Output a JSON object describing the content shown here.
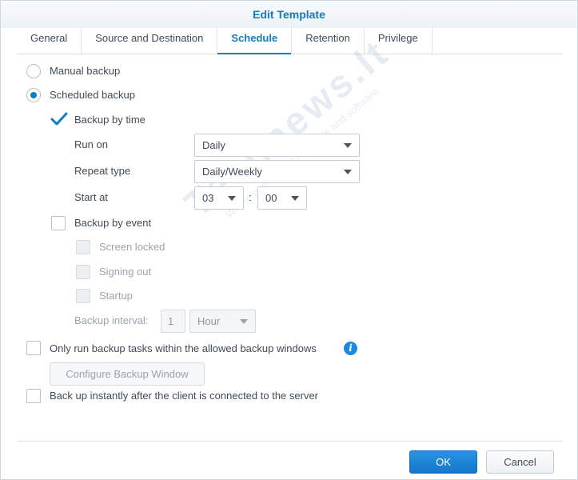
{
  "title": "Edit Template",
  "tabs": [
    {
      "label": "General",
      "active": false
    },
    {
      "label": "Source and Destination",
      "active": false
    },
    {
      "label": "Schedule",
      "active": true
    },
    {
      "label": "Retention",
      "active": false
    },
    {
      "label": "Privilege",
      "active": false
    }
  ],
  "schedule": {
    "manual_backup": {
      "label": "Manual backup",
      "checked": false
    },
    "scheduled_backup": {
      "label": "Scheduled backup",
      "checked": true
    },
    "backup_by_time": {
      "label": "Backup by time",
      "checked": true,
      "run_on": {
        "label": "Run on",
        "value": "Daily"
      },
      "repeat_type": {
        "label": "Repeat type",
        "value": "Daily/Weekly"
      },
      "start_at": {
        "label": "Start at",
        "hour": "03",
        "separator": ":",
        "minute": "00"
      }
    },
    "backup_by_event": {
      "label": "Backup by event",
      "checked": false,
      "events": [
        {
          "label": "Screen locked",
          "checked": false
        },
        {
          "label": "Signing out",
          "checked": false
        },
        {
          "label": "Startup",
          "checked": false
        }
      ],
      "interval": {
        "label": "Backup interval:",
        "value": "1",
        "unit": "Hour"
      }
    },
    "backup_window": {
      "label": "Only run backup tasks within the allowed backup windows",
      "checked": false
    },
    "configure_button": "Configure Backup Window",
    "instant_backup": {
      "label": "Back up instantly after the client is connected to the server",
      "checked": false
    }
  },
  "buttons": {
    "ok": "OK",
    "cancel": "Cancel"
  },
  "watermark": {
    "brand": "Technews.lt",
    "tagline": "Where geeks meet hardware and software"
  },
  "colors": {
    "accent": "#0e7dc2",
    "primary_button": "#1a82d6",
    "info_icon": "#1b8ade"
  },
  "icons": {
    "info": "info-icon",
    "check": "check-icon"
  }
}
